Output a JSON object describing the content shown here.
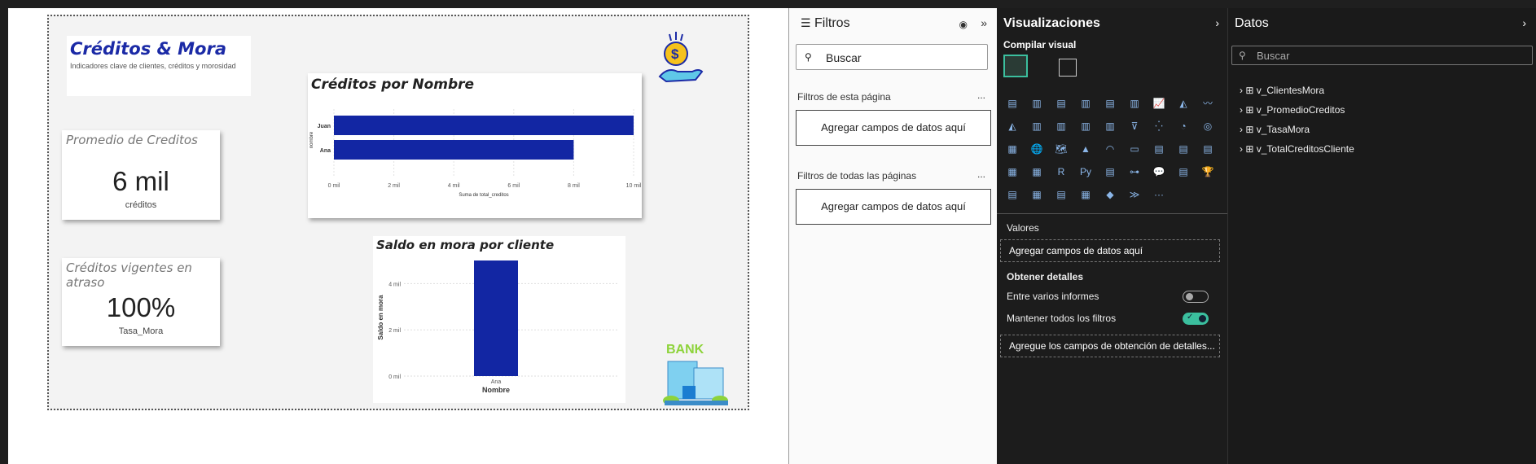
{
  "report": {
    "title": "Créditos & Mora",
    "subtitle": "Indicadores clave de clientes, créditos y morosidad",
    "kpi1": {
      "label": "Promedio de Creditos",
      "value": "6 mil",
      "sub": "créditos"
    },
    "kpi2": {
      "label": "Créditos vigentes en atraso",
      "value": "100%",
      "sub": "Tasa_Mora"
    },
    "bank_label": "BANK"
  },
  "chart_data": [
    {
      "type": "bar",
      "orientation": "horizontal",
      "title": "Créditos por Nombre",
      "categories": [
        "Juan",
        "Ana"
      ],
      "values": [
        10000,
        8000
      ],
      "xlabel": "Suma de total_creditos",
      "ylabel": "nombre",
      "xlim": [
        0,
        10000
      ],
      "ticks": [
        "0 mil",
        "2 mil",
        "4 mil",
        "6 mil",
        "8 mil",
        "10 mil"
      ],
      "color": "#1226a3"
    },
    {
      "type": "bar",
      "title": "Saldo en mora por cliente",
      "categories": [
        "Ana"
      ],
      "values": [
        5000
      ],
      "xlabel": "Nombre",
      "ylabel": "Saldo en mora",
      "ylim": [
        0,
        5000
      ],
      "ticks": [
        "0 mil",
        "2 mil",
        "4 mil"
      ],
      "color": "#1226a3"
    }
  ],
  "filters": {
    "title": "Filtros",
    "search_placeholder": "Buscar",
    "page_filters": "Filtros de esta página",
    "all_filters": "Filtros de todas las páginas",
    "drop": "Agregar campos de datos aquí",
    "more": "..."
  },
  "viz": {
    "title": "Visualizaciones",
    "build": "Compilar visual",
    "values_label": "Valores",
    "values_drop": "Agregar campos de datos aquí",
    "details_label": "Obtener detalles",
    "cross_reports": "Entre varios informes",
    "keep_filters": "Mantener todos los filtros",
    "details_drop": "Agregue los campos de obtención de detalles...",
    "icons": [
      "▤",
      "▥",
      "▤",
      "▥",
      "▤",
      "▥",
      "📈",
      "◭",
      "〰",
      "◭",
      "▥",
      "▥",
      "▥",
      "▥",
      "⊽",
      "⁛",
      "◔",
      "◎",
      "▦",
      "🌐",
      "🗺",
      "▲",
      "◠",
      "▭",
      "▤",
      "▤",
      "▤",
      "▦",
      "▦",
      "R",
      "Py",
      "▤",
      "⊶",
      "💬",
      "▤",
      "🏆",
      "▤",
      "▦",
      "▤",
      "▦",
      "◆",
      "≫",
      "···"
    ]
  },
  "datos": {
    "title": "Datos",
    "search_placeholder": "Buscar",
    "tables": [
      "v_ClientesMora",
      "v_PromedioCreditos",
      "v_TasaMora",
      "v_TotalCreditosCliente"
    ]
  }
}
